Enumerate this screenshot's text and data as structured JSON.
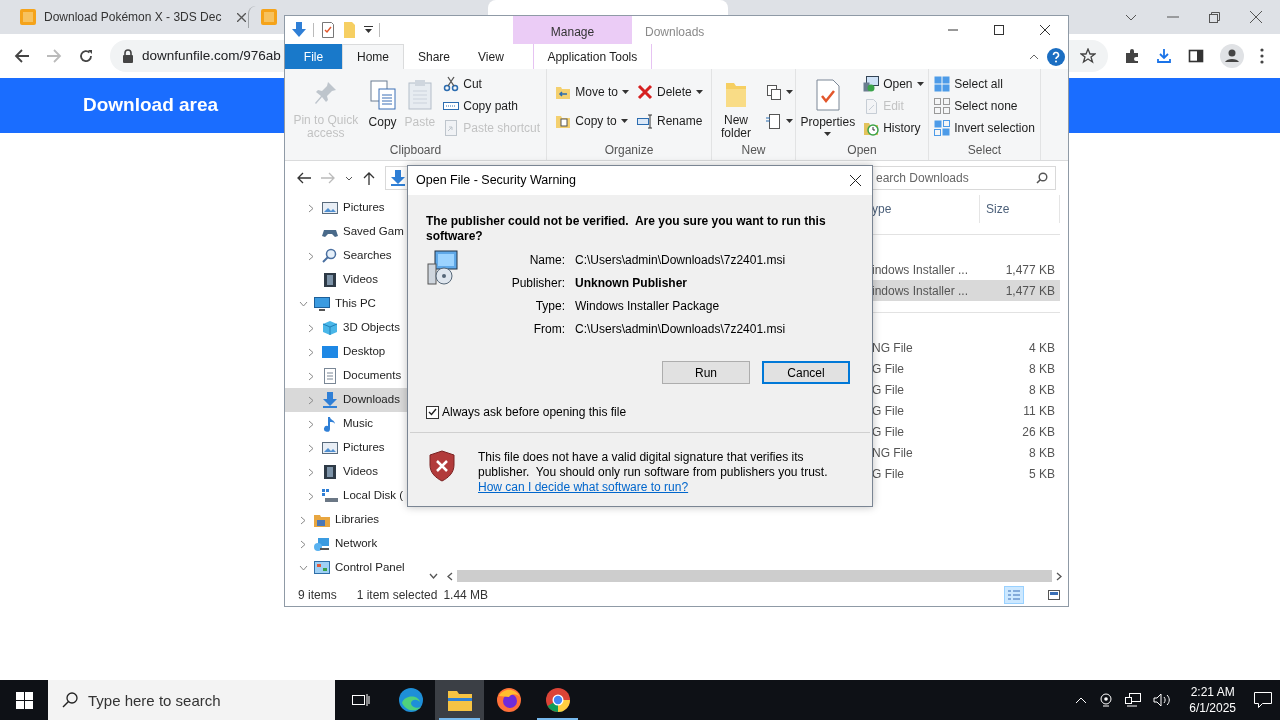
{
  "browser": {
    "tabs": [
      {
        "title": "Download Pokémon X - 3DS Dec",
        "selected": false
      },
      {
        "selected": false
      },
      {
        "selected": true
      }
    ],
    "address": "downfunfile.com/976ab",
    "banner_title": "Download area"
  },
  "explorer": {
    "title": "Downloads",
    "context_group": "Manage",
    "file_tab": "File",
    "tabs": [
      {
        "label": "Home",
        "selected": true,
        "kind": "standard"
      },
      {
        "label": "Share",
        "selected": false,
        "kind": "standard"
      },
      {
        "label": "View",
        "selected": false,
        "kind": "standard"
      },
      {
        "label": "Application Tools",
        "selected": false,
        "kind": "contextual"
      }
    ],
    "ribbon_groups": [
      {
        "label": "Clipboard",
        "columns": [
          [
            {
              "label": "Pin to Quick access",
              "kind": "large",
              "disabled": true,
              "dropdown": false
            }
          ],
          [
            {
              "label": "Copy",
              "kind": "large",
              "disabled": false,
              "dropdown": false
            }
          ],
          [
            {
              "label": "Paste",
              "kind": "large",
              "disabled": true,
              "dropdown": false
            }
          ],
          [
            {
              "label": "Cut",
              "kind": "small",
              "disabled": false,
              "dropdown": false
            },
            {
              "label": "Copy path",
              "kind": "small",
              "disabled": false,
              "dropdown": false
            },
            {
              "label": "Paste shortcut",
              "kind": "small",
              "disabled": true,
              "dropdown": false
            }
          ]
        ]
      },
      {
        "label": "Organize",
        "columns": [
          [
            {
              "label": "Move to",
              "kind": "small",
              "disabled": false,
              "dropdown": true
            },
            {
              "label": "Copy to",
              "kind": "small",
              "disabled": false,
              "dropdown": true
            }
          ],
          [
            {
              "label": "Delete",
              "kind": "small",
              "disabled": false,
              "dropdown": true
            },
            {
              "label": "Rename",
              "kind": "small",
              "disabled": false,
              "dropdown": false
            }
          ]
        ]
      },
      {
        "label": "New",
        "columns": [
          [
            {
              "label": "New folder",
              "kind": "large",
              "disabled": false,
              "dropdown": false
            }
          ],
          [
            {
              "kind": "small",
              "disabled": false,
              "dropdown": true
            },
            {
              "kind": "small",
              "disabled": false,
              "dropdown": true
            }
          ]
        ]
      },
      {
        "label": "Open",
        "columns": [
          [
            {
              "label": "Properties",
              "kind": "large",
              "disabled": false,
              "dropdown": true
            }
          ],
          [
            {
              "label": "Open",
              "kind": "small",
              "disabled": false,
              "dropdown": true
            },
            {
              "label": "Edit",
              "kind": "small",
              "disabled": true,
              "dropdown": false
            },
            {
              "label": "History",
              "kind": "small",
              "disabled": false,
              "dropdown": false
            }
          ]
        ]
      },
      {
        "label": "Select",
        "columns": [
          [
            {
              "label": "Select all",
              "kind": "small",
              "disabled": false,
              "dropdown": false
            },
            {
              "label": "Select none",
              "kind": "small",
              "disabled": false,
              "dropdown": false
            },
            {
              "label": "Invert selection",
              "kind": "small",
              "disabled": false,
              "dropdown": false
            }
          ]
        ]
      }
    ],
    "search": {
      "placeholder": "earch Downloads"
    },
    "nav_tree": [
      {
        "children": [
          {
            "label": "Pictures",
            "expandable": true,
            "expanded": false,
            "selected": false
          },
          {
            "label": "Saved Gam",
            "expandable": false,
            "selected": false
          },
          {
            "label": "Searches",
            "expandable": true,
            "expanded": false,
            "selected": false
          },
          {
            "label": "Videos",
            "expandable": false,
            "selected": false
          }
        ]
      },
      {
        "label": "This PC",
        "expandable": true,
        "expanded": true,
        "selected": false,
        "children": [
          {
            "label": "3D Objects",
            "expandable": true,
            "expanded": false,
            "selected": false
          },
          {
            "label": "Desktop",
            "expandable": true,
            "expanded": false,
            "selected": false
          },
          {
            "label": "Documents",
            "expandable": true,
            "expanded": false,
            "selected": false
          },
          {
            "label": "Downloads",
            "expandable": true,
            "expanded": false,
            "selected": true
          },
          {
            "label": "Music",
            "expandable": true,
            "expanded": false,
            "selected": false
          },
          {
            "label": "Pictures",
            "expandable": true,
            "expanded": false,
            "selected": false
          },
          {
            "label": "Videos",
            "expandable": true,
            "expanded": false,
            "selected": false
          },
          {
            "label": "Local Disk (",
            "expandable": true,
            "expanded": false,
            "selected": false
          }
        ]
      },
      {
        "label": "Libraries",
        "expandable": true,
        "expanded": false,
        "selected": false
      },
      {
        "label": "Network",
        "expandable": true,
        "expanded": false,
        "selected": false
      },
      {
        "label": "Control Panel",
        "expandable": true,
        "expanded": true,
        "selected": false
      }
    ],
    "columns": [
      "ype",
      "Size"
    ],
    "file_groups": [
      {
        "rows": [
          {
            "type": "indows Installer ...",
            "size": "1,477 KB",
            "selected": false
          },
          {
            "type": "indows Installer ...",
            "size": "1,477 KB",
            "selected": true
          }
        ]
      },
      {
        "rows": [
          {
            "type": "NG File",
            "size": "4 KB",
            "selected": false
          },
          {
            "type": "G File",
            "size": "8 KB",
            "selected": false
          },
          {
            "type": "G File",
            "size": "8 KB",
            "selected": false
          },
          {
            "type": "G File",
            "size": "11 KB",
            "selected": false
          },
          {
            "type": "G File",
            "size": "26 KB",
            "selected": false
          },
          {
            "type": "NG File",
            "size": "8 KB",
            "selected": false
          },
          {
            "type": "G File",
            "size": "5 KB",
            "selected": false
          }
        ]
      }
    ],
    "status": {
      "count": "9 items",
      "selection": "1 item selected",
      "size": "1.44 MB"
    }
  },
  "dialog": {
    "title": "Open File - Security Warning",
    "heading": "The publisher could not be verified.  Are you sure you want to run this software?",
    "fields": [
      {
        "label": "Name:",
        "value": "C:\\Users\\admin\\Downloads\\7z2401.msi",
        "emphasis": false
      },
      {
        "label": "Publisher:",
        "value": "Unknown Publisher",
        "emphasis": true
      },
      {
        "label": "Type:",
        "value": "Windows Installer Package",
        "emphasis": false
      },
      {
        "label": "From:",
        "value": "C:\\Users\\admin\\Downloads\\7z2401.msi",
        "emphasis": false
      }
    ],
    "buttons": [
      {
        "label": "Run",
        "default": false
      },
      {
        "label": "Cancel",
        "default": true
      }
    ],
    "checkbox": {
      "label": "Always ask before opening this file",
      "checked": true
    },
    "warning": "This file does not have a valid digital signature that verifies its publisher.  You should only run software from publishers you trust.",
    "link": "How can I decide what software to run?"
  },
  "taskbar": {
    "search_placeholder": "Type here to search",
    "apps": [
      {
        "active": false,
        "running": false
      },
      {
        "active": true,
        "running": true
      },
      {
        "active": false,
        "running": false
      },
      {
        "active": false,
        "running": true
      }
    ],
    "time": "2:21 AM",
    "date": "6/1/2025"
  }
}
